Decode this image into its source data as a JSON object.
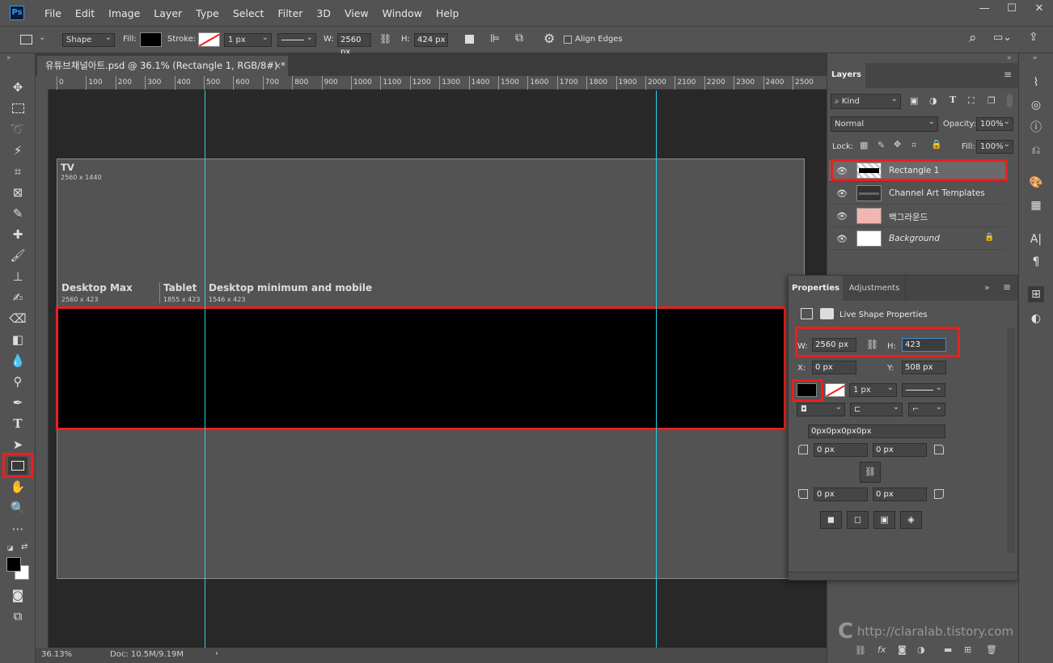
{
  "app": {
    "logo": "Ps",
    "name": "Adobe Photoshop"
  },
  "menu": [
    "File",
    "Edit",
    "Image",
    "Layer",
    "Type",
    "Select",
    "Filter",
    "3D",
    "View",
    "Window",
    "Help"
  ],
  "window_buttons": {
    "minimize": "—",
    "maximize": "☐",
    "close": "✕"
  },
  "options": {
    "mode": "Shape",
    "fill_label": "Fill:",
    "stroke_label": "Stroke:",
    "stroke_width": "1 px",
    "w_label": "W:",
    "w_value": "2560 px",
    "h_label": "H:",
    "h_value": "424 px",
    "align_edges": "Align Edges"
  },
  "document": {
    "tab_title": "유튜브채널아트.psd @ 36.1% (Rectangle 1, RGB/8#) *",
    "close": "×",
    "zoom": "36.13%",
    "doc_info": "Doc: 10.5M/9.19M",
    "ruler_ticks": [
      "0",
      "100",
      "200",
      "300",
      "400",
      "500",
      "600",
      "700",
      "800",
      "900",
      "1000",
      "1100",
      "1200",
      "1300",
      "1400",
      "1500",
      "1600",
      "1700",
      "1800",
      "1900",
      "2000",
      "2100",
      "2200",
      "2300",
      "2400",
      "2500"
    ]
  },
  "artboard": {
    "tv_label": "TV",
    "tv_size": "2560 x 1440",
    "desktop_max": "Desktop Max",
    "desktop_max_size": "2560 x 423",
    "tablet": "Tablet",
    "tablet_size": "1855 x 423",
    "desktop_min": "Desktop minimum and mobile",
    "desktop_min_size": "1546 x 423"
  },
  "layers_panel": {
    "tab": "Layers",
    "filter": "Kind",
    "blend": "Normal",
    "opacity_label": "Opacity:",
    "opacity": "100%",
    "lock_label": "Lock:",
    "fill_label": "Fill:",
    "fill": "100%",
    "layers": [
      {
        "name": "Rectangle 1",
        "selected": true
      },
      {
        "name": "Channel Art Templates",
        "selected": false
      },
      {
        "name": "백그라운드",
        "selected": false
      },
      {
        "name": "Background",
        "selected": false
      }
    ]
  },
  "properties_panel": {
    "tab_properties": "Properties",
    "tab_adjustments": "Adjustments",
    "live_shape": "Live Shape Properties",
    "w_label": "W:",
    "w_value": "2560 px",
    "h_label": "H:",
    "h_value": "423",
    "x_label": "X:",
    "x_value": "0 px",
    "y_label": "Y:",
    "y_value": "508 px",
    "stroke_width": "1 px",
    "corners_all": "0px0px0px0px",
    "corner_tl": "0 px",
    "corner_tr": "0 px",
    "corner_bl": "0 px",
    "corner_br": "0 px"
  },
  "watermark": "http://claralab.tistory.com",
  "colors": {
    "accent_red": "#e8201f",
    "guide": "#27d3ea",
    "ps_blue": "#2f9cf5"
  }
}
